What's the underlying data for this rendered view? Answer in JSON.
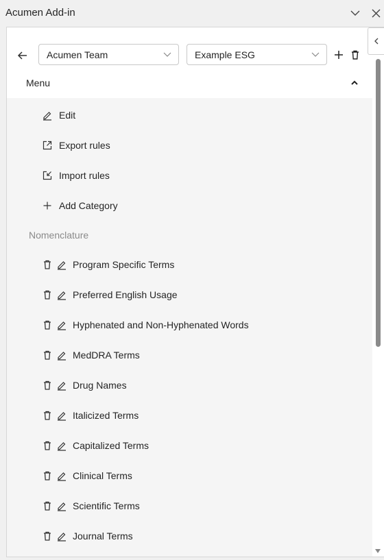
{
  "app": {
    "title": "Acumen Add-in"
  },
  "toolbar": {
    "team_select": "Acumen Team",
    "ruleset_select": "Example ESG"
  },
  "menu": {
    "label": "Menu",
    "actions": [
      {
        "label": "Edit",
        "icon": "pencil-icon"
      },
      {
        "label": "Export rules",
        "icon": "export-icon"
      },
      {
        "label": "Import rules",
        "icon": "import-icon"
      },
      {
        "label": "Add Category",
        "icon": "plus-icon"
      }
    ]
  },
  "section": {
    "title": "Nomenclature",
    "categories": [
      "Program Specific Terms",
      "Preferred English Usage",
      "Hyphenated and Non-Hyphenated Words",
      "MedDRA Terms",
      "Drug Names",
      "Italicized Terms",
      "Capitalized Terms",
      "Clinical Terms",
      "Scientific Terms",
      "Journal Terms"
    ]
  },
  "colors": {
    "scrollbar": "#8a8a8a",
    "panel_bg": "#ffffff",
    "menu_bg": "#f5f5f5"
  }
}
